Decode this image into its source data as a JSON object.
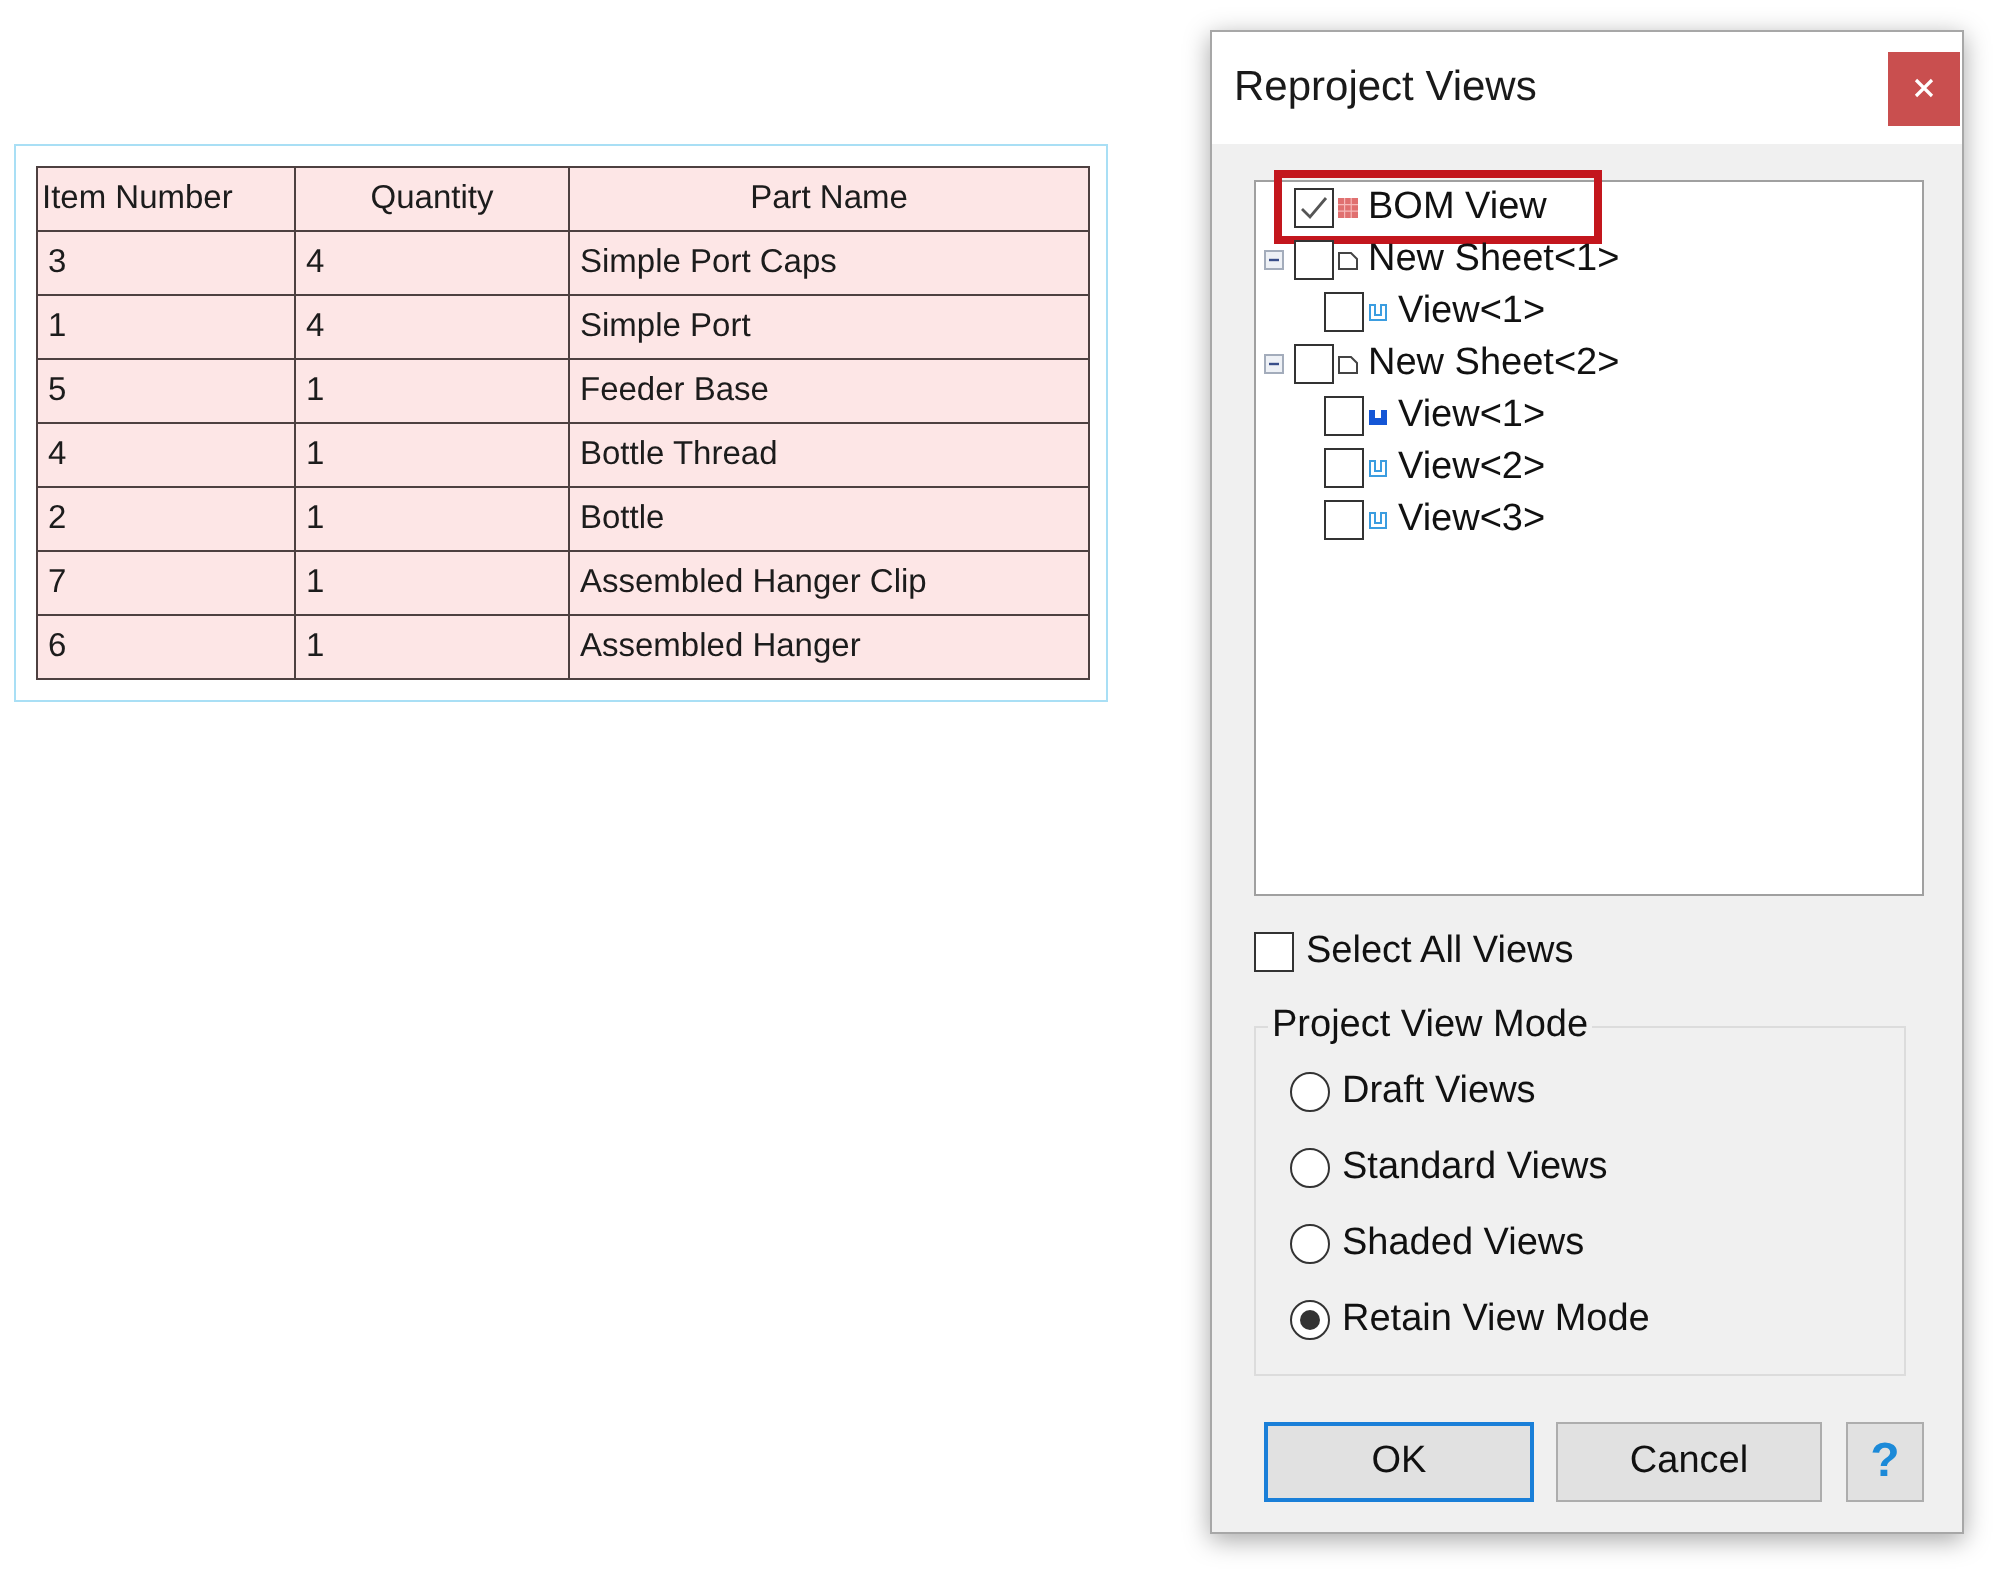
{
  "table": {
    "columns": [
      "Item Number",
      "Quantity",
      "Part Name"
    ],
    "rows": [
      [
        "3",
        "4",
        "Simple Port Caps"
      ],
      [
        "1",
        "4",
        "Simple Port"
      ],
      [
        "5",
        "1",
        "Feeder Base"
      ],
      [
        "4",
        "1",
        "Bottle Thread"
      ],
      [
        "2",
        "1",
        "Bottle"
      ],
      [
        "7",
        "1",
        "Assembled Hanger Clip"
      ],
      [
        "6",
        "1",
        "Assembled Hanger"
      ]
    ]
  },
  "dialog": {
    "title": "Reproject Views",
    "tree": [
      {
        "kind": "bom",
        "label": "BOM View",
        "checked": true,
        "highlighted": true
      },
      {
        "kind": "sheet",
        "label": "New Sheet<1>",
        "checked": false,
        "expanded": true,
        "highlighted": false,
        "children": [
          {
            "label": "View<1>",
            "checked": false,
            "active": false
          }
        ]
      },
      {
        "kind": "sheet",
        "label": "New Sheet<2>",
        "checked": false,
        "expanded": true,
        "highlighted": false,
        "children": [
          {
            "label": "View<1>",
            "checked": false,
            "active": true
          },
          {
            "label": "View<2>",
            "checked": false,
            "active": false
          },
          {
            "label": "View<3>",
            "checked": false,
            "active": false
          }
        ]
      }
    ],
    "select_all": {
      "label": "Select All Views",
      "checked": false
    },
    "view_mode": {
      "title": "Project View Mode",
      "options": [
        {
          "label": "Draft Views",
          "selected": false
        },
        {
          "label": "Standard Views",
          "selected": false
        },
        {
          "label": "Shaded Views",
          "selected": false
        },
        {
          "label": "Retain View Mode",
          "selected": true
        }
      ]
    },
    "buttons": [
      {
        "kind": "ok",
        "label": "OK",
        "default": true
      },
      {
        "kind": "cancel",
        "label": "Cancel",
        "default": false
      },
      {
        "kind": "help",
        "label": "?",
        "default": false
      }
    ]
  }
}
